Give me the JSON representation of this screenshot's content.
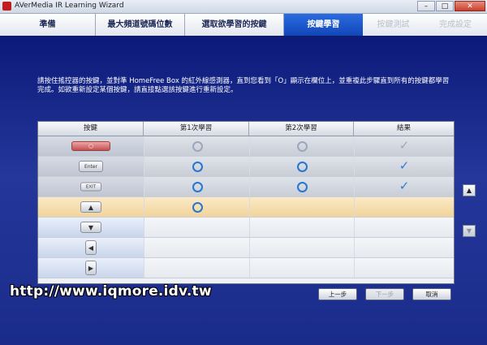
{
  "window": {
    "title": "AVerMedia IR Learning Wizard",
    "buttons": {
      "minimize": "–",
      "maximize": "□",
      "close": "✕"
    }
  },
  "tabs": [
    {
      "label": "準備",
      "state": "normal"
    },
    {
      "label": "最大頻道號碼位數",
      "state": "normal"
    },
    {
      "label": "選取欲學習的按鍵",
      "state": "normal"
    },
    {
      "label": "按鍵學習",
      "state": "active"
    },
    {
      "label": "按鍵測試",
      "state": "disabled"
    },
    {
      "label": "完成設定",
      "state": "disabled"
    }
  ],
  "instructions": "請按住搖控器的按鍵，並對準 HomeFree Box 的紅外線感測器，直到您看到「O」顯示在欄位上，並重複此步驟直到所有的按鍵都學習完成。如欲重新設定某個按鍵，請直接點選該按鍵進行重新設定。",
  "table": {
    "headers": [
      "按鍵",
      "第1次學習",
      "第2次學習",
      "結果"
    ],
    "rows": [
      {
        "key": "○",
        "icon": "power-key-icon",
        "first": "O",
        "second": "O",
        "result": "✓",
        "faint": true
      },
      {
        "key": "Enter",
        "icon": "enter-key-icon",
        "first": "O",
        "second": "O",
        "result": "✓",
        "faint": false
      },
      {
        "key": "EXIT",
        "icon": "exit-key-icon",
        "first": "O",
        "second": "O",
        "result": "✓",
        "faint": false
      },
      {
        "key": "▲",
        "icon": "up-arrow-key-icon",
        "first": "O",
        "second": "",
        "result": "",
        "faint": false,
        "highlight": true
      },
      {
        "key": "▼",
        "icon": "down-arrow-key-icon",
        "first": "",
        "second": "",
        "result": "",
        "faint": false
      },
      {
        "key": "◀",
        "icon": "left-arrow-key-icon",
        "first": "",
        "second": "",
        "result": "",
        "faint": false
      },
      {
        "key": "▶",
        "icon": "right-arrow-key-icon",
        "first": "",
        "second": "",
        "result": "",
        "faint": false
      }
    ]
  },
  "scroll": {
    "up": "▲",
    "down": "▼"
  },
  "footer": {
    "watermark": "http://www.iqmore.idv.tw",
    "back_label": "上一步",
    "next_label": "下一步",
    "cancel_label": "取消"
  }
}
